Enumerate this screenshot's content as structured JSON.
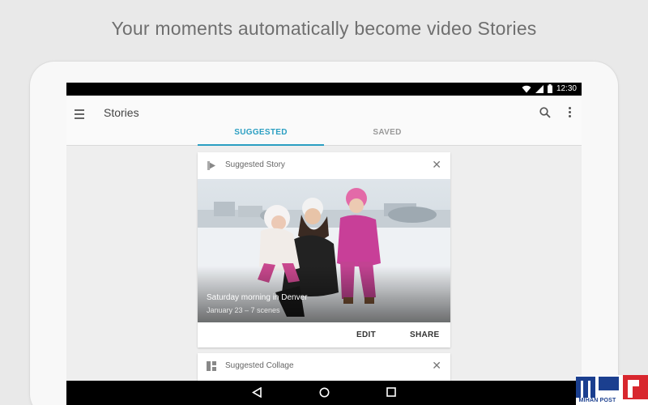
{
  "headline": "Your moments automatically become video Stories",
  "status_bar": {
    "time": "12:30",
    "icons": [
      "wifi-icon",
      "signal-icon",
      "battery-icon"
    ]
  },
  "app_bar": {
    "title": "Stories",
    "icons": [
      "menu-icon",
      "search-icon",
      "more-vert-icon"
    ]
  },
  "tabs": [
    {
      "label": "SUGGESTED",
      "active": true
    },
    {
      "label": "SAVED",
      "active": false
    }
  ],
  "cards": [
    {
      "type_label": "Suggested Story",
      "icon": "movie-icon",
      "photo_title": "Saturday morning in Denver",
      "photo_subtitle": "January 23 – 7 scenes",
      "actions": [
        "EDIT",
        "SHARE"
      ]
    },
    {
      "type_label": "Suggested Collage",
      "icon": "collage-icon"
    }
  ],
  "nav_bar": {
    "icons": [
      "back-icon",
      "home-icon",
      "recents-icon"
    ]
  },
  "watermark": {
    "text": "MIHAN POST"
  },
  "colors": {
    "accent": "#2b9fc2",
    "status_bar": "#000000",
    "background": "#e9e9e9"
  }
}
